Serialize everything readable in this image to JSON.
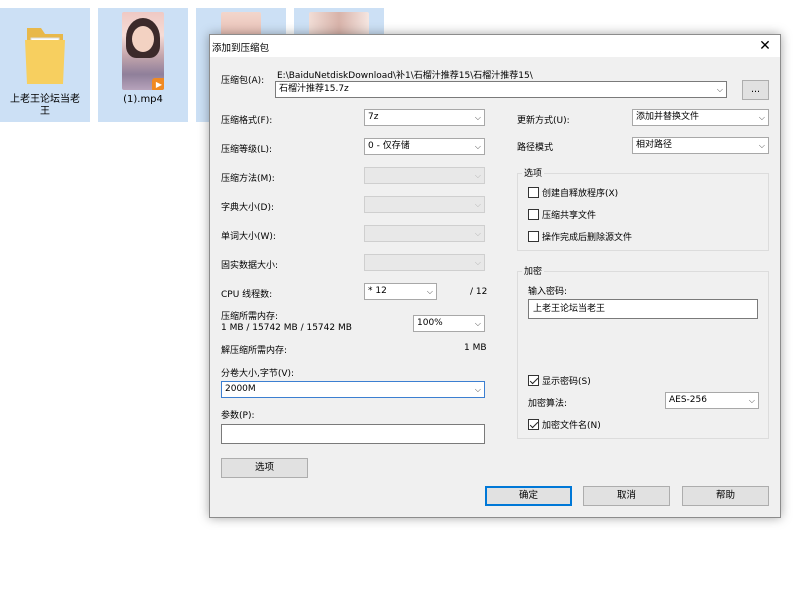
{
  "desktop": {
    "items": [
      {
        "name": "上老王论坛当老\n王"
      },
      {
        "name": "(1).mp4"
      },
      {
        "name": ""
      },
      {
        "name": ""
      }
    ]
  },
  "dialog": {
    "title": "添加到压缩包",
    "archive_label": "压缩包(A):",
    "archive_path": "E:\\BaiduNetdiskDownload\\补1\\石榴汁推荐15\\石榴汁推荐15\\",
    "archive_name": "石榴汁推荐15.7z",
    "browse_label": "...",
    "format_label": "压缩格式(F):",
    "format_value": "7z",
    "level_label": "压缩等级(L):",
    "level_value": "0 - 仅存储",
    "method_label": "压缩方法(M):",
    "dict_label": "字典大小(D):",
    "word_label": "单词大小(W):",
    "solid_label": "固实数据大小:",
    "threads_label": "CPU 线程数:",
    "threads_value": "* 12",
    "threads_max": "/ 12",
    "mem_comp_label": "压缩所需内存:",
    "mem_comp_value": "1 MB / 15742 MB / 15742 MB",
    "mem_percent": "100%",
    "mem_decomp_label": "解压缩所需内存:",
    "mem_decomp_value": "1 MB",
    "split_label": "分卷大小,字节(V):",
    "split_value": "2000M",
    "params_label": "参数(P):",
    "params_value": "",
    "options_button": "选项",
    "update_label": "更新方式(U):",
    "update_value": "添加并替换文件",
    "path_label": "路径模式",
    "path_value": "相对路径",
    "options_group": "选项",
    "opt_sfx": "创建自释放程序(X)",
    "opt_shared": "压缩共享文件",
    "opt_delete": "操作完成后删除源文件",
    "encrypt_group": "加密",
    "password_label": "输入密码:",
    "password_value": "上老王论坛当老王",
    "show_password": "显示密码(S)",
    "enc_method_label": "加密算法:",
    "enc_method_value": "AES-256",
    "encrypt_names": "加密文件名(N)",
    "ok": "确定",
    "cancel": "取消",
    "help": "帮助"
  }
}
